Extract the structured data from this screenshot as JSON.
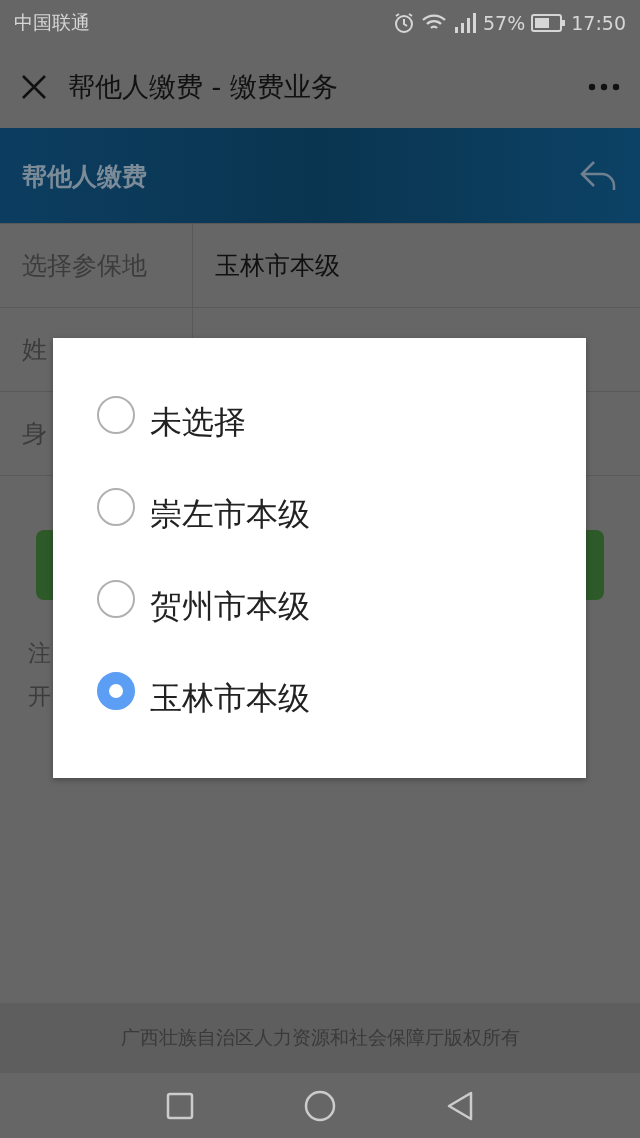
{
  "status_bar": {
    "carrier": "中国联通",
    "battery": "57%",
    "time": "17:50"
  },
  "nav_bar": {
    "title": "帮他人缴费 - 缴费业务"
  },
  "banner": {
    "title": "帮他人缴费"
  },
  "form": {
    "rows": [
      {
        "label": "选择参保地",
        "value": "玉林市本级"
      },
      {
        "label": "姓"
      },
      {
        "label": "身"
      }
    ]
  },
  "note": {
    "lines": [
      "注",
      "开"
    ]
  },
  "dialog": {
    "options": [
      {
        "label": "未选择",
        "selected": false
      },
      {
        "label": "崇左市本级",
        "selected": false
      },
      {
        "label": "贺州市本级",
        "selected": false
      },
      {
        "label": "玉林市本级",
        "selected": true
      }
    ]
  },
  "footer": {
    "text": "广西壮族自治区人力资源和社会保障厅版权所有"
  }
}
